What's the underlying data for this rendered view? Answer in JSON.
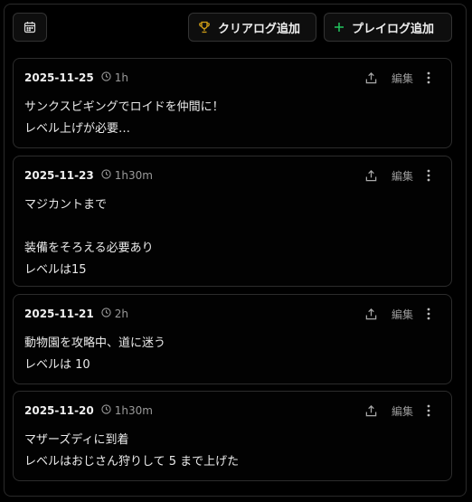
{
  "toolbar": {
    "calendar_icon": "calendar-icon",
    "clear_log_label": "クリアログ追加",
    "play_log_label": "プレイログ追加",
    "accent_gold": "#d4a017",
    "accent_green": "#22c55e"
  },
  "entries": [
    {
      "date": "2025-11-25",
      "duration": "1h",
      "edit_label": "編集",
      "lines": [
        "サンクスビギングでロイドを仲間に！",
        "レベル上げが必要…"
      ]
    },
    {
      "date": "2025-11-23",
      "duration": "1h30m",
      "edit_label": "編集",
      "lines": [
        "マジカントまで",
        "",
        "装備をそろえる必要あり",
        "レベルは15"
      ]
    },
    {
      "date": "2025-11-21",
      "duration": "2h",
      "edit_label": "編集",
      "lines": [
        "動物園を攻略中、道に迷う",
        "レベルは 10"
      ]
    },
    {
      "date": "2025-11-20",
      "duration": "1h30m",
      "edit_label": "編集",
      "lines": [
        "マザーズディに到着",
        "レベルはおじさん狩りして 5 まで上げた"
      ]
    }
  ]
}
